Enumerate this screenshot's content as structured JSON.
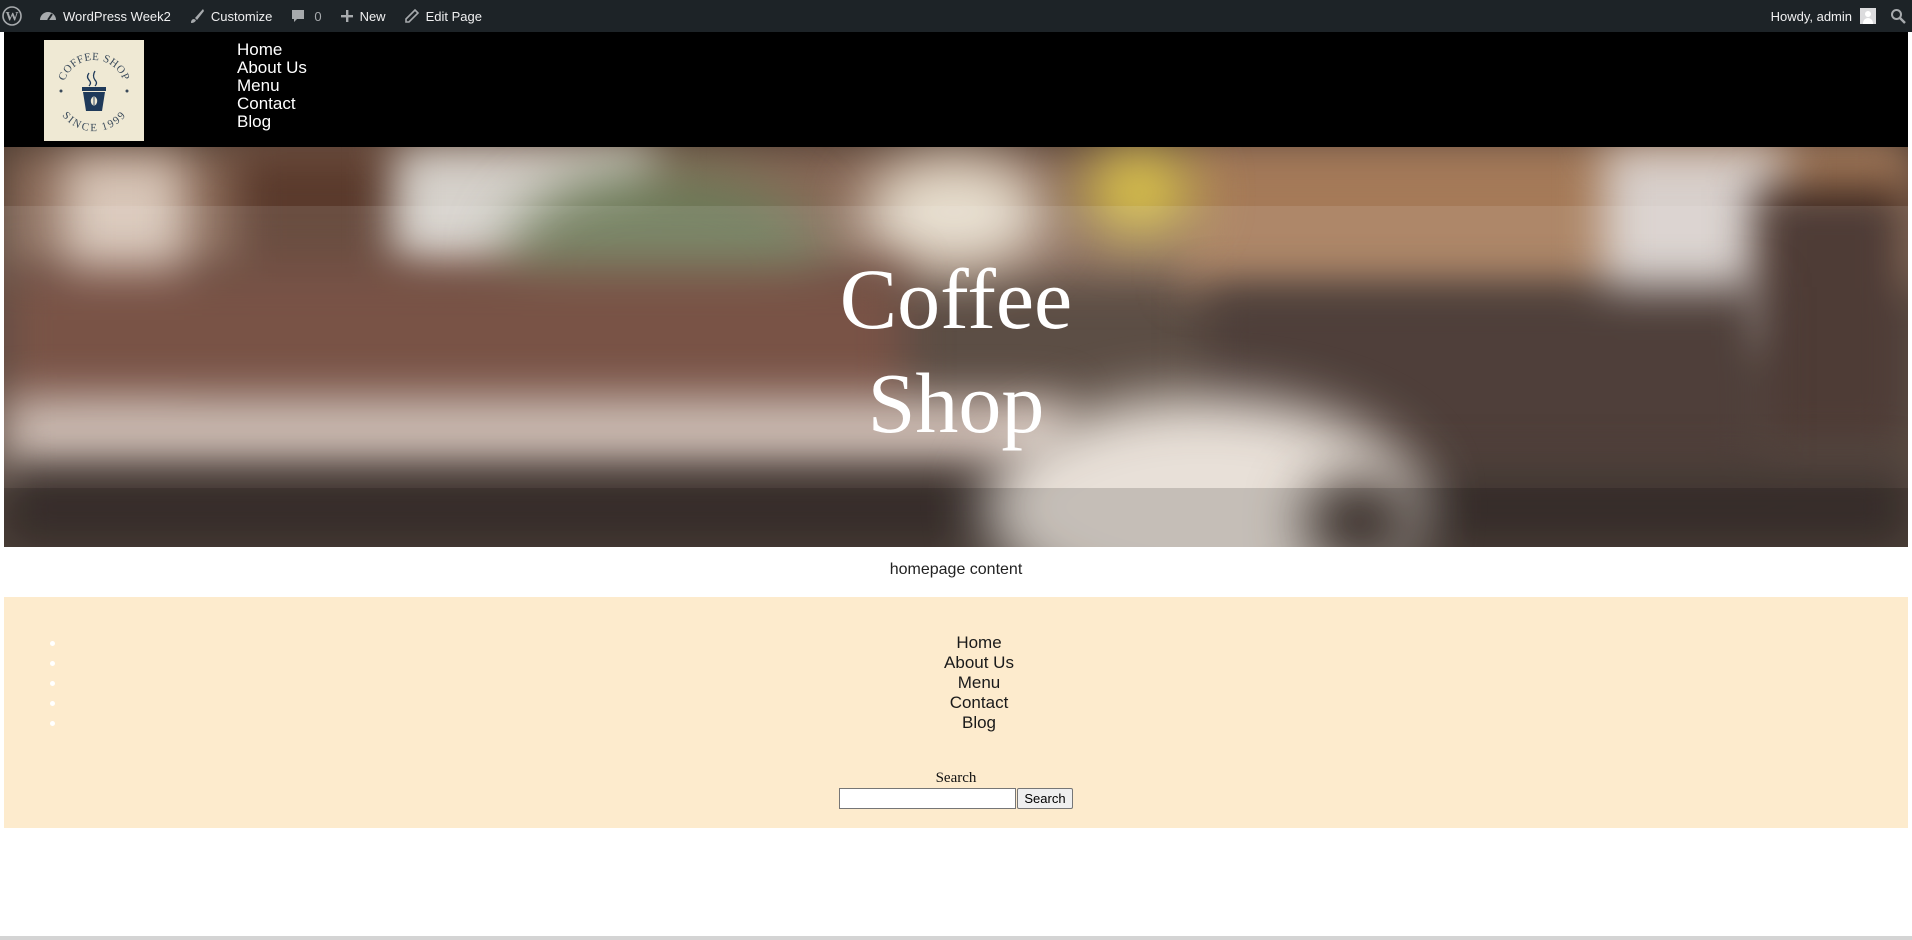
{
  "admin_bar": {
    "site_name": "WordPress Week2",
    "customize": "Customize",
    "comments_count": "0",
    "new": "New",
    "edit_page": "Edit Page",
    "howdy": "Howdy, admin",
    "background": "#1d2327"
  },
  "header": {
    "logo_text_top": "COFFEE SHOP",
    "logo_text_bottom": "SINCE 1999",
    "nav": [
      "Home",
      "About Us",
      "Menu",
      "Contact",
      "Blog"
    ]
  },
  "hero": {
    "title_line1": "Coffee",
    "title_line2": "Shop"
  },
  "content": {
    "text": "homepage content"
  },
  "footer": {
    "background": "#fdebcd",
    "nav": [
      "Home",
      "About Us",
      "Menu",
      "Contact",
      "Blog"
    ],
    "search_label": "Search",
    "search_value": "",
    "search_button": "Search"
  }
}
